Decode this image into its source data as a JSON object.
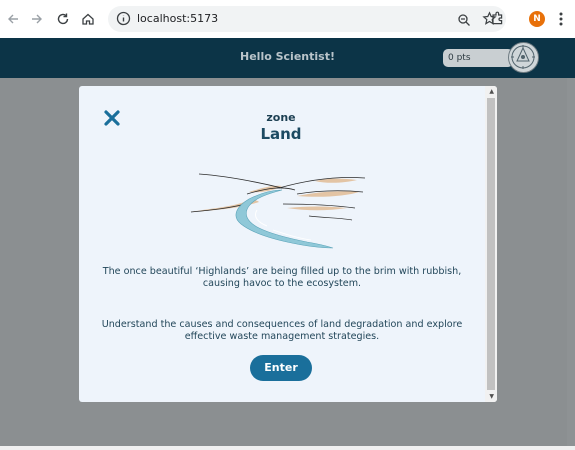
{
  "browser": {
    "url": "localhost:5173",
    "profile_initial": "N"
  },
  "app": {
    "greeting": "Hello Scientist!",
    "points": "0 pts"
  },
  "modal": {
    "zone_label": "zone",
    "title": "Land",
    "description_1": "The once beautiful ‘Highlands’ are being filled up to the brim with rubbish, causing havoc to the ecosystem.",
    "description_2": "Understand the causes and consequences of land degradation and explore effective waste management strategies.",
    "enter_label": "Enter"
  },
  "colors": {
    "header_bg": "#0c3447",
    "overlay_bg": "#8b8f91",
    "modal_bg": "#eef4fb",
    "accent": "#1a6f9b",
    "river": "#8fc8d8",
    "sand": "#e3c4a4"
  },
  "icons": {
    "back": "back-arrow-icon",
    "forward": "forward-arrow-icon",
    "reload": "reload-icon",
    "home": "home-icon",
    "site_info": "info-icon",
    "zoom": "zoom-icon",
    "bookmark": "star-icon",
    "extensions": "puzzle-icon",
    "menu": "kebab-menu-icon",
    "close": "close-icon",
    "avatar": "compass-avatar-icon"
  }
}
